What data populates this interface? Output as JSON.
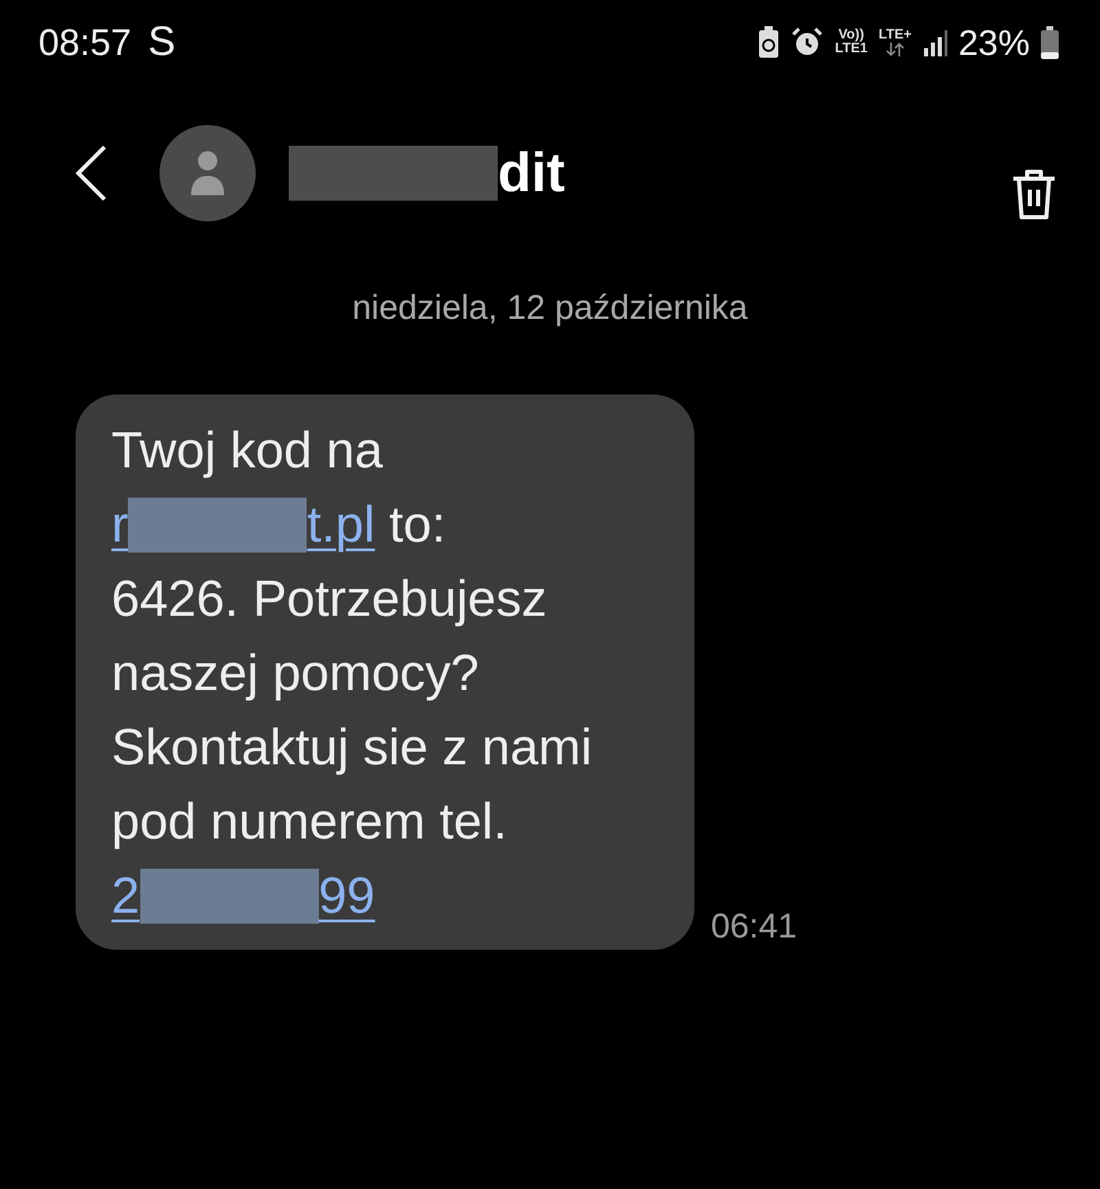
{
  "status_bar": {
    "time": "08:57",
    "carrier_mark": "S",
    "volte": "Vo))",
    "volte_line": "LTE1",
    "network": "LTE+",
    "battery": "23%"
  },
  "header": {
    "title_parts": [
      {
        "kind": "redaction"
      },
      {
        "kind": "text",
        "text": "dit"
      }
    ]
  },
  "date_separator": "niedziela, 12 października",
  "messages": [
    {
      "time": "06:41",
      "lines": [
        [
          {
            "kind": "text",
            "text": "Twoj kod na"
          }
        ],
        [
          {
            "kind": "link",
            "text": "r"
          },
          {
            "kind": "link_redaction"
          },
          {
            "kind": "link",
            "text": "t.pl"
          },
          {
            "kind": "text",
            "text": " to:"
          }
        ],
        [
          {
            "kind": "text",
            "text": "6426. Potrzebujesz"
          }
        ],
        [
          {
            "kind": "text",
            "text": "naszej pomocy?"
          }
        ],
        [
          {
            "kind": "text",
            "text": "Skontaktuj sie z nami"
          }
        ],
        [
          {
            "kind": "text",
            "text": "pod numerem tel."
          }
        ],
        [
          {
            "kind": "link",
            "text": "2"
          },
          {
            "kind": "link_redaction"
          },
          {
            "kind": "link",
            "text": "99"
          }
        ]
      ]
    }
  ]
}
